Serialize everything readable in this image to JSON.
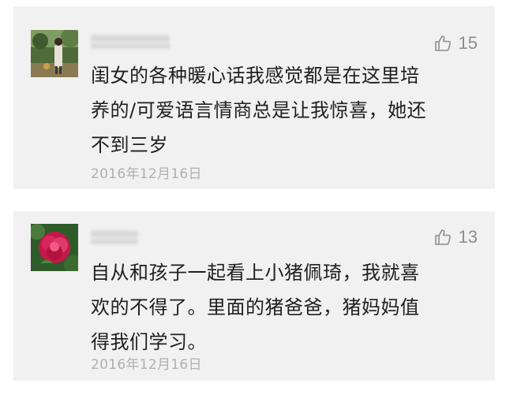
{
  "comments": [
    {
      "avatar": "avatar-photo-person-outdoors",
      "likes": "15",
      "text": "闺女的各种暖心话我感觉都是在这里培\n养的/可爱语言情商总是让我惊喜，她还\n不到三岁",
      "date": "2016年12月16日"
    },
    {
      "avatar": "avatar-photo-red-flower",
      "likes": "13",
      "text": "自从和孩子一起看上小猪佩琦，我就喜\n欢的不得了。里面的猪爸爸，猪妈妈值\n得我们学习。",
      "date": "2016年12月16日"
    }
  ],
  "icons": {
    "like": "thumbs-up-icon"
  },
  "colors": {
    "card_background": "#f1f1f1",
    "text": "#1e1e1e",
    "meta": "#8d8d8d",
    "date": "#b0b0b0"
  }
}
